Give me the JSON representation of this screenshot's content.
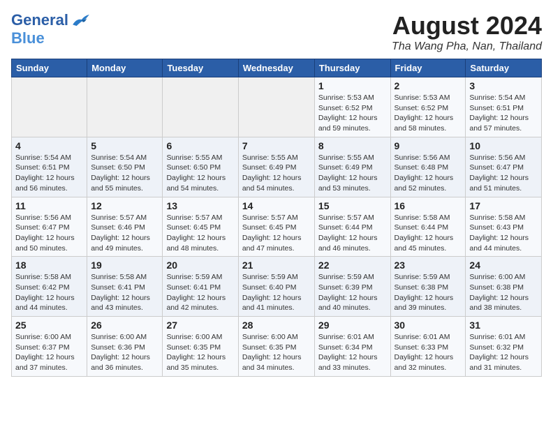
{
  "logo": {
    "general": "General",
    "blue": "Blue"
  },
  "title": {
    "month_year": "August 2024",
    "location": "Tha Wang Pha, Nan, Thailand"
  },
  "weekdays": [
    "Sunday",
    "Monday",
    "Tuesday",
    "Wednesday",
    "Thursday",
    "Friday",
    "Saturday"
  ],
  "weeks": [
    [
      {
        "day": "",
        "info": ""
      },
      {
        "day": "",
        "info": ""
      },
      {
        "day": "",
        "info": ""
      },
      {
        "day": "",
        "info": ""
      },
      {
        "day": "1",
        "info": "Sunrise: 5:53 AM\nSunset: 6:52 PM\nDaylight: 12 hours\nand 59 minutes."
      },
      {
        "day": "2",
        "info": "Sunrise: 5:53 AM\nSunset: 6:52 PM\nDaylight: 12 hours\nand 58 minutes."
      },
      {
        "day": "3",
        "info": "Sunrise: 5:54 AM\nSunset: 6:51 PM\nDaylight: 12 hours\nand 57 minutes."
      }
    ],
    [
      {
        "day": "4",
        "info": "Sunrise: 5:54 AM\nSunset: 6:51 PM\nDaylight: 12 hours\nand 56 minutes."
      },
      {
        "day": "5",
        "info": "Sunrise: 5:54 AM\nSunset: 6:50 PM\nDaylight: 12 hours\nand 55 minutes."
      },
      {
        "day": "6",
        "info": "Sunrise: 5:55 AM\nSunset: 6:50 PM\nDaylight: 12 hours\nand 54 minutes."
      },
      {
        "day": "7",
        "info": "Sunrise: 5:55 AM\nSunset: 6:49 PM\nDaylight: 12 hours\nand 54 minutes."
      },
      {
        "day": "8",
        "info": "Sunrise: 5:55 AM\nSunset: 6:49 PM\nDaylight: 12 hours\nand 53 minutes."
      },
      {
        "day": "9",
        "info": "Sunrise: 5:56 AM\nSunset: 6:48 PM\nDaylight: 12 hours\nand 52 minutes."
      },
      {
        "day": "10",
        "info": "Sunrise: 5:56 AM\nSunset: 6:47 PM\nDaylight: 12 hours\nand 51 minutes."
      }
    ],
    [
      {
        "day": "11",
        "info": "Sunrise: 5:56 AM\nSunset: 6:47 PM\nDaylight: 12 hours\nand 50 minutes."
      },
      {
        "day": "12",
        "info": "Sunrise: 5:57 AM\nSunset: 6:46 PM\nDaylight: 12 hours\nand 49 minutes."
      },
      {
        "day": "13",
        "info": "Sunrise: 5:57 AM\nSunset: 6:45 PM\nDaylight: 12 hours\nand 48 minutes."
      },
      {
        "day": "14",
        "info": "Sunrise: 5:57 AM\nSunset: 6:45 PM\nDaylight: 12 hours\nand 47 minutes."
      },
      {
        "day": "15",
        "info": "Sunrise: 5:57 AM\nSunset: 6:44 PM\nDaylight: 12 hours\nand 46 minutes."
      },
      {
        "day": "16",
        "info": "Sunrise: 5:58 AM\nSunset: 6:44 PM\nDaylight: 12 hours\nand 45 minutes."
      },
      {
        "day": "17",
        "info": "Sunrise: 5:58 AM\nSunset: 6:43 PM\nDaylight: 12 hours\nand 44 minutes."
      }
    ],
    [
      {
        "day": "18",
        "info": "Sunrise: 5:58 AM\nSunset: 6:42 PM\nDaylight: 12 hours\nand 44 minutes."
      },
      {
        "day": "19",
        "info": "Sunrise: 5:58 AM\nSunset: 6:41 PM\nDaylight: 12 hours\nand 43 minutes."
      },
      {
        "day": "20",
        "info": "Sunrise: 5:59 AM\nSunset: 6:41 PM\nDaylight: 12 hours\nand 42 minutes."
      },
      {
        "day": "21",
        "info": "Sunrise: 5:59 AM\nSunset: 6:40 PM\nDaylight: 12 hours\nand 41 minutes."
      },
      {
        "day": "22",
        "info": "Sunrise: 5:59 AM\nSunset: 6:39 PM\nDaylight: 12 hours\nand 40 minutes."
      },
      {
        "day": "23",
        "info": "Sunrise: 5:59 AM\nSunset: 6:38 PM\nDaylight: 12 hours\nand 39 minutes."
      },
      {
        "day": "24",
        "info": "Sunrise: 6:00 AM\nSunset: 6:38 PM\nDaylight: 12 hours\nand 38 minutes."
      }
    ],
    [
      {
        "day": "25",
        "info": "Sunrise: 6:00 AM\nSunset: 6:37 PM\nDaylight: 12 hours\nand 37 minutes."
      },
      {
        "day": "26",
        "info": "Sunrise: 6:00 AM\nSunset: 6:36 PM\nDaylight: 12 hours\nand 36 minutes."
      },
      {
        "day": "27",
        "info": "Sunrise: 6:00 AM\nSunset: 6:35 PM\nDaylight: 12 hours\nand 35 minutes."
      },
      {
        "day": "28",
        "info": "Sunrise: 6:00 AM\nSunset: 6:35 PM\nDaylight: 12 hours\nand 34 minutes."
      },
      {
        "day": "29",
        "info": "Sunrise: 6:01 AM\nSunset: 6:34 PM\nDaylight: 12 hours\nand 33 minutes."
      },
      {
        "day": "30",
        "info": "Sunrise: 6:01 AM\nSunset: 6:33 PM\nDaylight: 12 hours\nand 32 minutes."
      },
      {
        "day": "31",
        "info": "Sunrise: 6:01 AM\nSunset: 6:32 PM\nDaylight: 12 hours\nand 31 minutes."
      }
    ]
  ]
}
